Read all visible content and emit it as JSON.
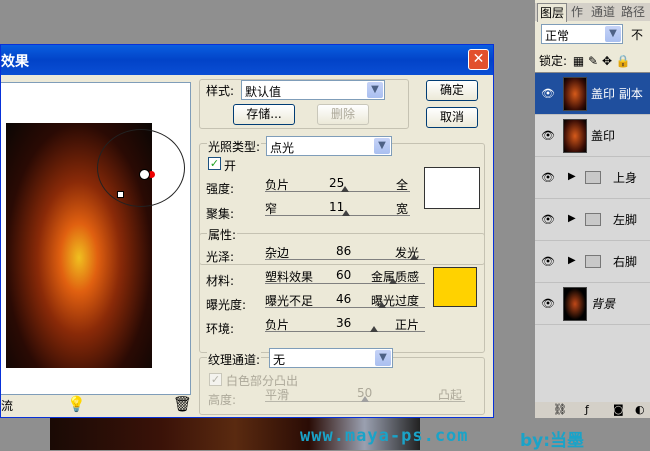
{
  "watermark": {
    "url": "www.maya-ps.com",
    "by": "by:当墨"
  },
  "dialog": {
    "title": "效果",
    "style_label": "样式:",
    "style_value": "默认值",
    "save_button": "存储...",
    "delete_button": "删除",
    "ok_button": "确定",
    "cancel_button": "取消",
    "light_type": {
      "group_label": "光照类型:",
      "value": "点光",
      "on_label": "开",
      "on_checked": true,
      "intensity": {
        "label": "强度:",
        "left": "负片",
        "value": "25",
        "right": "全",
        "fraction": 0.55
      },
      "focus": {
        "label": "聚集:",
        "left": "窄",
        "value": "11",
        "right": "宽",
        "fraction": 0.56
      },
      "color": "#ffffff"
    },
    "properties": {
      "group_label": "属性:",
      "gloss": {
        "label": "光泽:",
        "left": "杂边",
        "value": "86",
        "right": "发光",
        "fraction": 0.93
      },
      "material": {
        "label": "材料:",
        "left": "塑料效果",
        "value": "60",
        "right": "金属质感",
        "fraction": 0.8
      },
      "exposure": {
        "label": "曝光度:",
        "left": "曝光不足",
        "value": "46",
        "right": "曝光过度",
        "fraction": 0.73
      },
      "ambience": {
        "label": "环境:",
        "left": "负片",
        "value": "36",
        "right": "正片",
        "fraction": 0.68
      },
      "color": "#ffd200"
    },
    "texture": {
      "label": "纹理通道:",
      "value": "无",
      "white_high_label": "白色部分凸出",
      "height_label": "高度:",
      "left": "平滑",
      "value_num": "50",
      "right": "凸起",
      "fraction": 0.5
    },
    "bottom_label": "流"
  },
  "layers_panel": {
    "tabs": [
      "图层",
      "作",
      "通道",
      "路径"
    ],
    "blend_mode": "正常",
    "opacity_label": "不",
    "lock_label": "锁定:",
    "layers": [
      {
        "name": "盖印 副本",
        "selected": true,
        "type": "image"
      },
      {
        "name": "盖印",
        "selected": false,
        "type": "image"
      },
      {
        "name": "上身",
        "selected": false,
        "type": "folder"
      },
      {
        "name": "左脚",
        "selected": false,
        "type": "folder"
      },
      {
        "name": "右脚",
        "selected": false,
        "type": "folder"
      },
      {
        "name": "背景",
        "selected": false,
        "type": "image"
      }
    ]
  }
}
